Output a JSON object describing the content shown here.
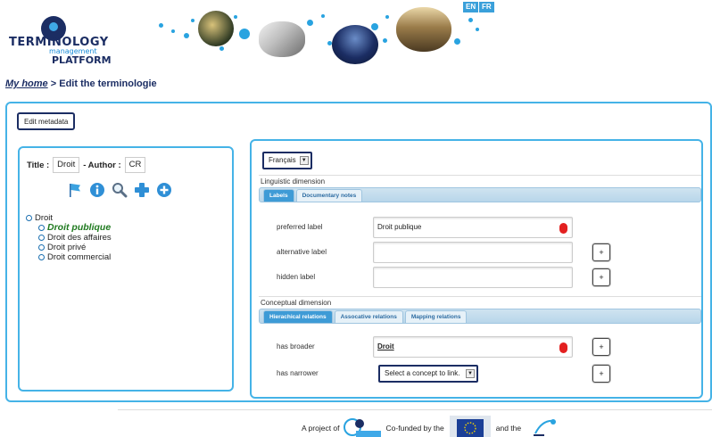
{
  "header": {
    "logo": {
      "line1": "TERMINOLOGY",
      "line2": "management",
      "line3": "PLATFORM"
    },
    "languages": [
      "EN",
      "FR"
    ]
  },
  "breadcrumb": {
    "home": "My home",
    "separator": " > ",
    "current": "Edit the terminologie"
  },
  "toolbar": {
    "edit_metadata_label": "Edit metadata"
  },
  "terminology": {
    "title_label": "Title :",
    "title_value": "Droit",
    "author_label": "- Author :",
    "author_value": "CR",
    "tools": [
      "flag-icon",
      "info-icon",
      "search-icon",
      "add-cross-icon",
      "add-circle-icon"
    ]
  },
  "tree": {
    "root": "Droit",
    "children": [
      "Droit publique",
      "Droit des affaires",
      "Droit privé",
      "Droit commercial"
    ],
    "selected": "Droit publique"
  },
  "editor": {
    "language_select": "Français",
    "linguistic": {
      "title": "Linguistic dimension",
      "tabs": [
        "Labels",
        "Documentary notes"
      ],
      "active_tab": "Labels",
      "fields": [
        {
          "label": "preferred label",
          "value": "Droit publique"
        },
        {
          "label": "alternative label",
          "value": ""
        },
        {
          "label": "hidden label",
          "value": ""
        }
      ]
    },
    "conceptual": {
      "title": "Conceptual dimension",
      "tabs": [
        "Hierachical relations",
        "Assocative relations",
        "Mapping relations"
      ],
      "active_tab": "Hierachical relations",
      "fields": [
        {
          "label": "has broader",
          "value": "Droit"
        },
        {
          "label": "has narrower",
          "value": "Select a concept to link."
        }
      ]
    },
    "plus_label": "+"
  },
  "footer": {
    "project_text": "A project of",
    "cofunded_text": "Co-funded by the",
    "and_text": "and the"
  },
  "colors": {
    "accent": "#45b3e7",
    "navy": "#1b2d63",
    "tree_active": "#1f7a1f",
    "delete": "#e32020"
  }
}
